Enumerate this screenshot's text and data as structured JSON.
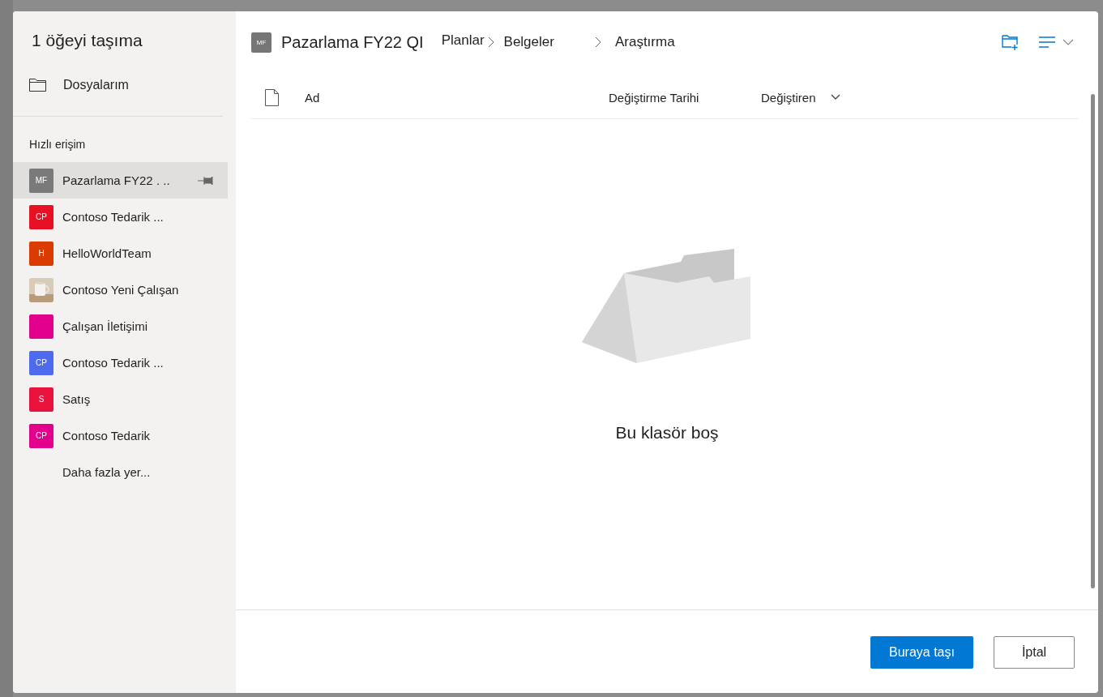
{
  "dialog": {
    "title": "1 öğeyi taşıma"
  },
  "sidebar": {
    "my_files": "Dosyalarım",
    "section_label": "Hızlı erişim",
    "items": [
      {
        "kind": "initials",
        "initials": "MF",
        "label": "Pazarlama FY22 . ..",
        "color": "#7a7a7a",
        "selected": true,
        "pinned": true
      },
      {
        "kind": "initials",
        "initials": "CP",
        "label": "Contoso Tedarik ...",
        "color": "#e81123",
        "selected": false,
        "pinned": false
      },
      {
        "kind": "initials",
        "initials": "H",
        "label": "HelloWorldTeam",
        "color": "#da3b01",
        "selected": false,
        "pinned": false
      },
      {
        "kind": "picture",
        "label": "Contoso Yeni Çalışan",
        "selected": false,
        "pinned": false
      },
      {
        "kind": "initials",
        "label": "Çalışan İletişimi",
        "color": "#e3008c",
        "selected": false,
        "pinned": false
      },
      {
        "kind": "initials",
        "initials": "CP",
        "label": "Contoso Tedarik ...",
        "color": "#4f6bed",
        "selected": false,
        "pinned": false
      },
      {
        "kind": "initials",
        "initials": "S",
        "label": "Satış",
        "color": "#e8123c",
        "selected": false,
        "pinned": false
      },
      {
        "kind": "initials",
        "initials": "CP",
        "label": "Contoso Tedarik",
        "color": "#e3008c",
        "selected": false,
        "pinned": false
      },
      {
        "kind": "more",
        "label": "Daha fazla yer...",
        "selected": false,
        "pinned": false
      }
    ]
  },
  "breadcrumb": {
    "site_initials": "MF",
    "site": "Pazarlama FY22 QI",
    "path": [
      "Planlar",
      "Belgeler",
      "Araştırma"
    ]
  },
  "table": {
    "columns": [
      "Ad",
      "Değiştirme Tarihi",
      "Değiştiren"
    ]
  },
  "empty_state": {
    "message": "Bu klasör boş"
  },
  "buttons": {
    "primary": "Buraya taşı",
    "secondary": "İptal"
  }
}
